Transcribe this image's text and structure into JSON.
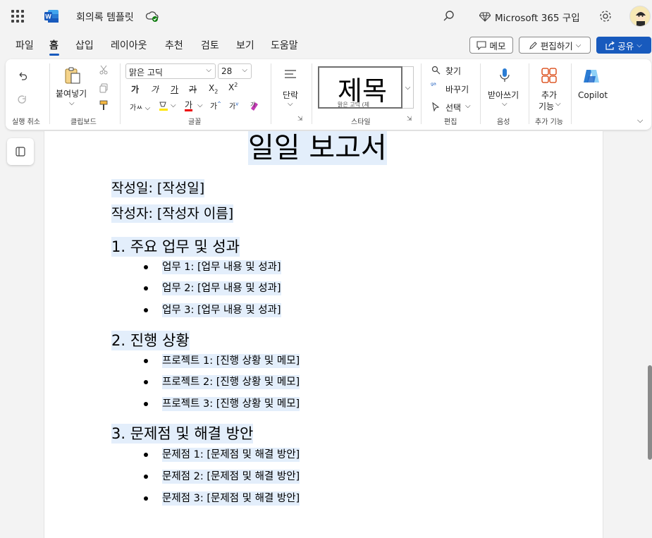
{
  "titlebar": {
    "doc_title": "회의록 템플릿",
    "ms365_label": "Microsoft 365 구입"
  },
  "tabs": [
    "파일",
    "홈",
    "삽입",
    "레이아웃",
    "추천",
    "검토",
    "보기",
    "도움말"
  ],
  "active_tab": "홈",
  "actions": {
    "memo": "메모",
    "edit": "편집하기",
    "share": "공유"
  },
  "ribbon": {
    "undo_group": "실행 취소",
    "paste": "붙여넣기",
    "clipboard_group": "클립보드",
    "font_name": "맑은 고딕",
    "font_size": "28",
    "font_group": "글꼴",
    "paragraph": "단락",
    "style_preview": "제목",
    "style_preview_sub": "맑은 고딕 (제",
    "style_group": "스타일",
    "find": "찾기",
    "replace": "바꾸기",
    "select": "선택",
    "edit_group": "편집",
    "dictate": "받아쓰기",
    "voice_group": "음성",
    "addins": "추가",
    "addins2": "기능",
    "addins_group": "추가 기능",
    "copilot": "Copilot"
  },
  "document": {
    "title": "일일 보고서",
    "meta": [
      "작성일: [작성일]",
      "작성자: [작성자 이름]"
    ],
    "sections": [
      {
        "heading": "1. 주요 업무 및 성과",
        "items": [
          "업무 1: [업무 내용 및 성과]",
          "업무 2: [업무 내용 및 성과]",
          "업무 3: [업무 내용 및 성과]"
        ]
      },
      {
        "heading": "2. 진행 상황",
        "items": [
          "프로젝트 1: [진행 상황 및 메모]",
          "프로젝트 2: [진행 상황 및 메모]",
          "프로젝트 3: [진행 상황 및 메모]"
        ]
      },
      {
        "heading": "3. 문제점 및 해결 방안",
        "items": [
          "문제점 1: [문제점 및 해결 방안]",
          "문제점 2: [문제점 및 해결 방안]",
          "문제점 3: [문제점 및 해결 방안]"
        ]
      }
    ]
  },
  "colors": {
    "accent": "#185abd",
    "highlight": "#e3eefb"
  }
}
